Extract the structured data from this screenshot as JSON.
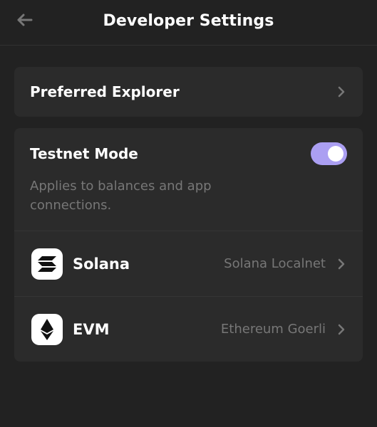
{
  "header": {
    "title": "Developer Settings",
    "back_icon": "arrow-left-icon"
  },
  "preferred_explorer": {
    "label": "Preferred Explorer",
    "chevron_icon": "chevron-right-icon"
  },
  "testnet": {
    "label": "Testnet Mode",
    "enabled": true,
    "description": "Applies to balances and app connections.",
    "networks": [
      {
        "name": "Solana",
        "value": "Solana Localnet",
        "icon": "solana-logo-icon"
      },
      {
        "name": "EVM",
        "value": "Ethereum Goerli",
        "icon": "ethereum-logo-icon"
      }
    ]
  },
  "colors": {
    "background": "#222222",
    "card": "#2b2b2b",
    "accent": "#ab9ff2",
    "muted_text": "#777777"
  }
}
